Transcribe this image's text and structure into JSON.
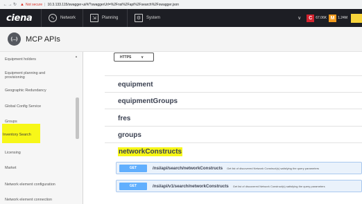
{
  "browser": {
    "not_secure": "Not secure",
    "url": "10.3.133.115/swagger-ui/#/?swaggerUrl=%2Fnsi%2Fapi%2Fsearch%2Fswagger.json"
  },
  "header": {
    "brand": "ciena",
    "nav": [
      {
        "label": "Network",
        "icon": "network-icon"
      },
      {
        "label": "Planning",
        "icon": "planning-icon"
      },
      {
        "label": "System",
        "icon": "system-icon"
      }
    ],
    "alarms": [
      {
        "badge": "C",
        "count": "67.06K",
        "color": "#d3232f"
      },
      {
        "badge": "M",
        "count": "1.24M",
        "color": "#f29b1d"
      }
    ]
  },
  "api_header": {
    "logo_text": "{...}",
    "title": "MCP APIs"
  },
  "sidebar": {
    "items": [
      {
        "label": "Equipment holders",
        "highlighted": false
      },
      {
        "label": "Equipment planning and provisioning",
        "highlighted": false
      },
      {
        "label": "Geographic Redundancy",
        "highlighted": false
      },
      {
        "label": "Global Config Service",
        "highlighted": false
      },
      {
        "label": "Groups",
        "highlighted": false
      },
      {
        "label": "Inventory Search",
        "highlighted": true
      },
      {
        "label": "Licensing",
        "highlighted": false
      },
      {
        "label": "Market",
        "highlighted": false
      },
      {
        "label": "Network element configuration",
        "highlighted": false
      },
      {
        "label": "Network element connection",
        "highlighted": false
      }
    ]
  },
  "main": {
    "scheme": "HTTPS",
    "tags": [
      "equipment",
      "equipmentGroups",
      "fres",
      "groups",
      "networkConstructs"
    ],
    "highlighted_tag": "networkConstructs",
    "operations": [
      {
        "method": "GET",
        "path": "/nsi/api/search/networkConstructs",
        "description": "Get list of discovered Network Construct(s) satisfying the query parameters"
      },
      {
        "method": "GET",
        "path": "/nsi/api/v1/search/networkConstructs",
        "description": "Get list of discovered Network Construct(s) satisfying the query parameters"
      }
    ]
  },
  "colors": {
    "topbar": "#1d1e24",
    "get_method": "#61affe",
    "highlight": "#f7f718"
  }
}
